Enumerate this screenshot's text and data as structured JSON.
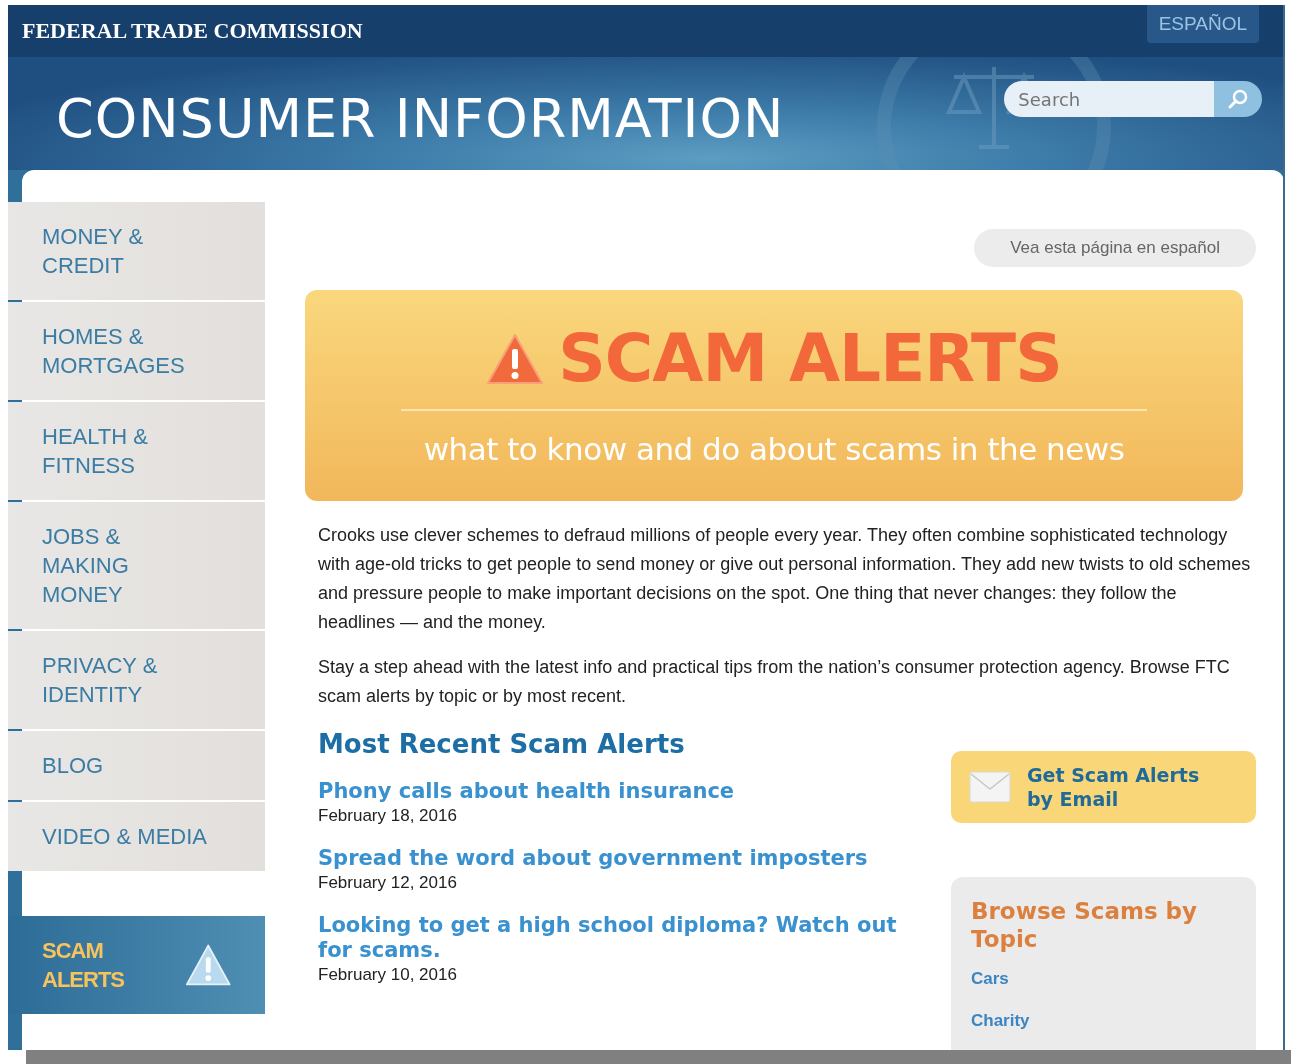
{
  "agency": "FEDERAL TRADE COMMISSION",
  "language_button": "ESPAÑOL",
  "site_title": "CONSUMER INFORMATION",
  "search": {
    "placeholder": "Search"
  },
  "sidebar": {
    "items": [
      {
        "label": "MONEY & CREDIT",
        "selected": false,
        "kind": "plain"
      },
      {
        "label": "HOMES & MORTGAGES",
        "selected": false,
        "kind": "plain"
      },
      {
        "label": "HEALTH & FITNESS",
        "selected": false,
        "kind": "plain"
      },
      {
        "label": "JOBS & MAKING MONEY",
        "selected": false,
        "kind": "plain"
      },
      {
        "label": "PRIVACY & IDENTITY",
        "selected": false,
        "kind": "plain"
      },
      {
        "label": "BLOG",
        "selected": false,
        "kind": "plain"
      },
      {
        "label": "VIDEO & MEDIA",
        "selected": false,
        "kind": "plain"
      },
      {
        "label": "SCAM ALERTS",
        "selected": true,
        "kind": "alert"
      }
    ]
  },
  "spanish_link": "Vea esta página en español",
  "banner": {
    "title": "SCAM ALERTS",
    "subtitle": "what to know and do about scams in the news"
  },
  "paragraphs": [
    "Crooks use clever schemes to defraud millions of people every year. They often combine sophisticated technology with age-old tricks to get people to send money or give out personal information. They add new twists to old schemes and pressure people to make important decisions on the spot. One thing that never changes: they follow the headlines — and the money.",
    "Stay a step ahead with the latest info and practical tips from the nation’s consumer protection agency. Browse FTC scam alerts by topic or by most recent."
  ],
  "recent": {
    "heading": "Most Recent Scam Alerts",
    "alerts": [
      {
        "title": "Phony calls about health insurance",
        "date": "February 18, 2016"
      },
      {
        "title": "Spread the word about government imposters",
        "date": "February 12, 2016"
      },
      {
        "title": "Looking to get a high school diploma? Watch out for scams.",
        "date": "February 10, 2016"
      }
    ]
  },
  "email_button": "Get Scam Alerts by Email",
  "topics": {
    "heading": "Browse Scams by Topic",
    "items": [
      "Cars",
      "Charity"
    ]
  }
}
